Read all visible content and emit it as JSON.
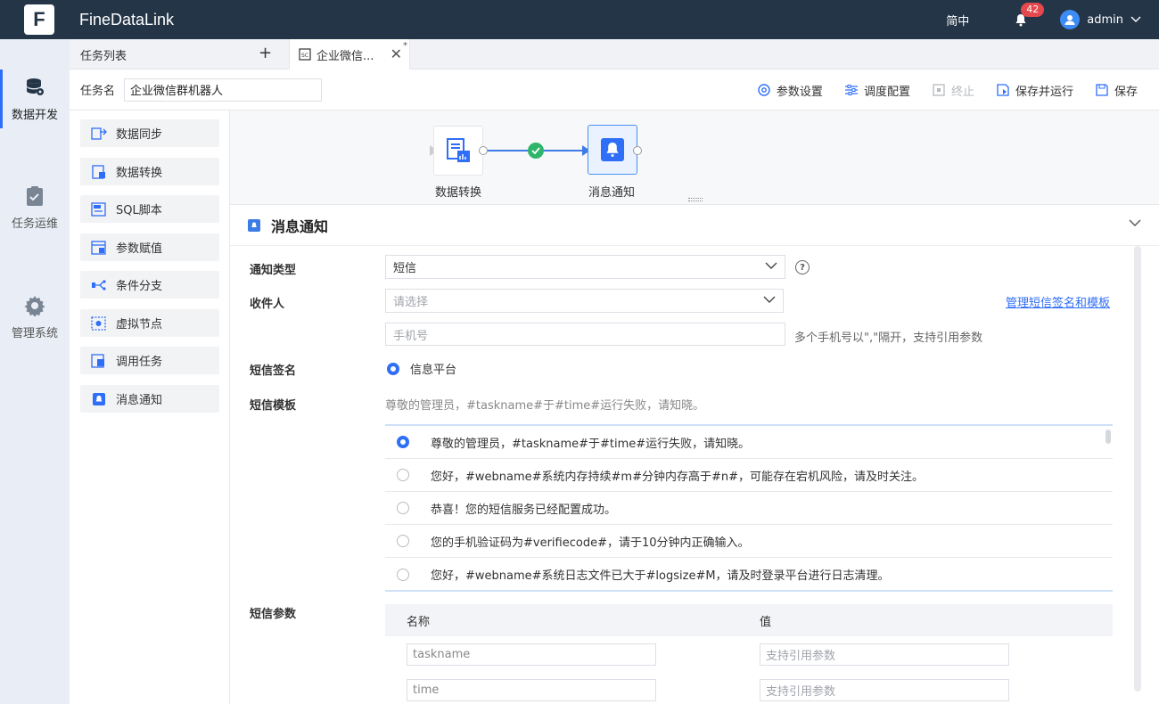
{
  "app": {
    "brand": "FineDataLink",
    "logo_letter": "F"
  },
  "topbar": {
    "language": "简中",
    "notifications": "42",
    "user": "admin"
  },
  "leftnav": [
    {
      "label": "数据开发",
      "icon": "database-icon",
      "active": true
    },
    {
      "label": "任务运维",
      "icon": "clipboard-icon",
      "active": false
    },
    {
      "label": "管理系统",
      "icon": "gear-icon",
      "active": false
    }
  ],
  "tabs": {
    "list_label": "任务列表",
    "active_tab": "企业微信...",
    "dirty_mark": "*"
  },
  "toolbar": {
    "task_name_label": "任务名",
    "task_name_value": "企业微信群机器人",
    "buttons": {
      "params": "参数设置",
      "schedule": "调度配置",
      "stop": "终止",
      "save_run": "保存并运行",
      "save": "保存"
    }
  },
  "components": [
    {
      "label": "数据同步",
      "icon": "data-sync-icon"
    },
    {
      "label": "数据转换",
      "icon": "data-transform-icon"
    },
    {
      "label": "SQL脚本",
      "icon": "sql-script-icon"
    },
    {
      "label": "参数赋值",
      "icon": "param-assign-icon"
    },
    {
      "label": "条件分支",
      "icon": "branch-icon"
    },
    {
      "label": "虚拟节点",
      "icon": "virtual-node-icon"
    },
    {
      "label": "调用任务",
      "icon": "call-task-icon"
    },
    {
      "label": "消息通知",
      "icon": "bell-icon"
    }
  ],
  "canvas": {
    "nodes": [
      {
        "label": "数据转换",
        "icon": "data-transform-icon"
      },
      {
        "label": "消息通知",
        "icon": "bell-icon"
      }
    ]
  },
  "panel": {
    "title": "消息通知",
    "notify_type_label": "通知类型",
    "notify_type_value": "短信",
    "help_glyph": "?",
    "recipient_label": "收件人",
    "recipient_placeholder": "请选择",
    "manage_link": "管理短信签名和模板",
    "phone_placeholder": "手机号",
    "phone_hint": "多个手机号以\",\"隔开，支持引用参数",
    "signature_label": "短信签名",
    "signature_option": "信息平台",
    "template_label": "短信模板",
    "template_current": "尊敬的管理员，#taskname#于#time#运行失败，请知晓。",
    "templates": [
      {
        "text": "尊敬的管理员，#taskname#于#time#运行失败，请知晓。",
        "selected": true
      },
      {
        "text": "您好，#webname#系统内存持续#m#分钟内存高于#n#，可能存在宕机风险，请及时关注。",
        "selected": false
      },
      {
        "text": "恭喜！您的短信服务已经配置成功。",
        "selected": false
      },
      {
        "text": "您的手机验证码为#verifiecode#，请于10分钟内正确输入。",
        "selected": false
      },
      {
        "text": "您好，#webname#系统日志文件已大于#logsize#M，请及时登录平台进行日志清理。",
        "selected": false
      }
    ],
    "params_label": "短信参数",
    "params_headers": {
      "name": "名称",
      "value": "值"
    },
    "params_rows": [
      {
        "name": "taskname",
        "value_placeholder": "支持引用参数"
      },
      {
        "name": "time",
        "value_placeholder": "支持引用参数"
      }
    ]
  }
}
